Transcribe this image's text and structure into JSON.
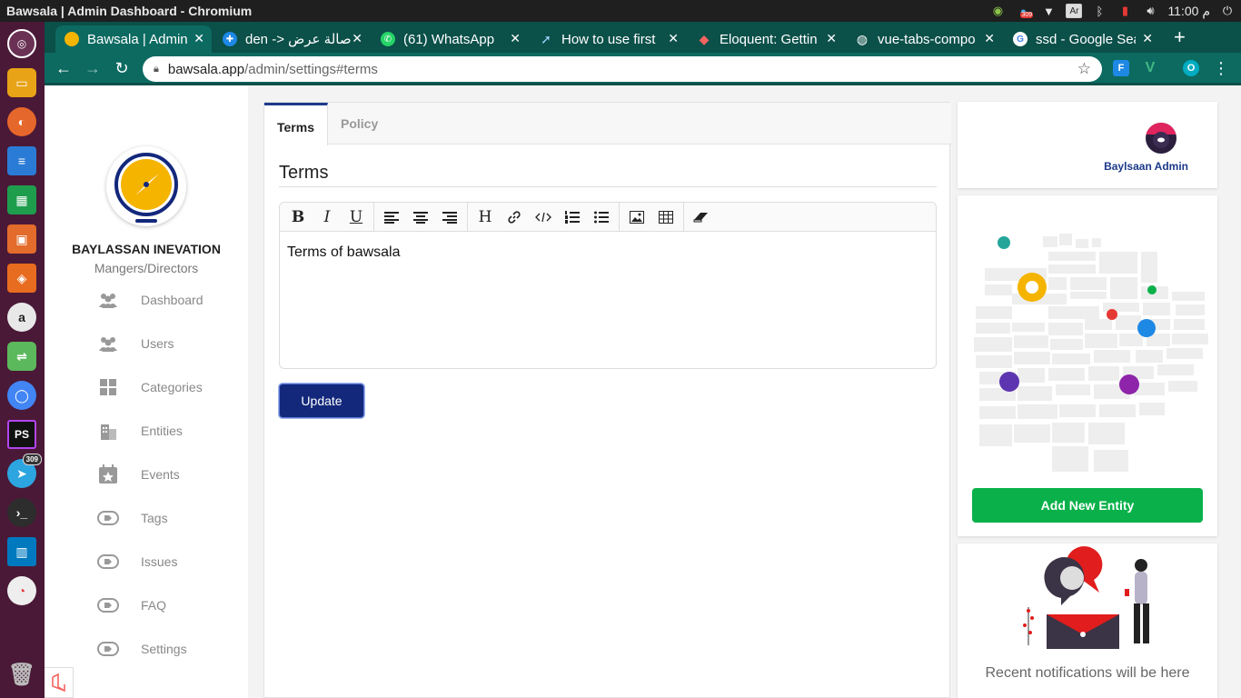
{
  "os": {
    "window_title": "Bawsala | Admin Dashboard - Chromium",
    "clock": "11:00 م",
    "badge_count": "309",
    "kbd_indicator": "Ar"
  },
  "dock": {
    "telegram_badge": "309"
  },
  "browser": {
    "tabs": [
      {
        "label": "Bawsala | Admin",
        "active": true
      },
      {
        "label": "den -> صالة عرض"
      },
      {
        "label": "(61) WhatsApp"
      },
      {
        "label": "How to use first"
      },
      {
        "label": "Eloquent: Gettin"
      },
      {
        "label": "vue-tabs-compo"
      },
      {
        "label": "ssd - Google Sea"
      }
    ],
    "url_host": "bawsala.app",
    "url_path": "/admin/settings#terms",
    "ext_v": "V",
    "ext_f": "F",
    "ext_profile": "O"
  },
  "sidebar": {
    "org_name": "BAYLASSAN INEVATION",
    "org_role": "Mangers/Directors",
    "items": [
      {
        "label": "Dashboard"
      },
      {
        "label": "Users"
      },
      {
        "label": "Categories"
      },
      {
        "label": "Entities"
      },
      {
        "label": "Events"
      },
      {
        "label": "Tags"
      },
      {
        "label": "Issues"
      },
      {
        "label": "FAQ"
      },
      {
        "label": "Settings"
      }
    ]
  },
  "main": {
    "tabs": [
      {
        "label": "Terms",
        "active": true
      },
      {
        "label": "Policy"
      }
    ],
    "section_title": "Terms",
    "editor_content": "Terms of bawsala",
    "toolbar": {
      "bold": "B",
      "italic": "I",
      "underline": "U",
      "heading": "H"
    },
    "update_label": "Update"
  },
  "right": {
    "admin_name": "Baylsaan Admin",
    "add_entity_label": "Add New Entity",
    "notifications_text": "Recent notifications will be here"
  },
  "colors": {
    "accent": "#13287b",
    "success": "#0ab14a",
    "browser_chrome": "#0c6a61",
    "dock": "#4a1937"
  }
}
